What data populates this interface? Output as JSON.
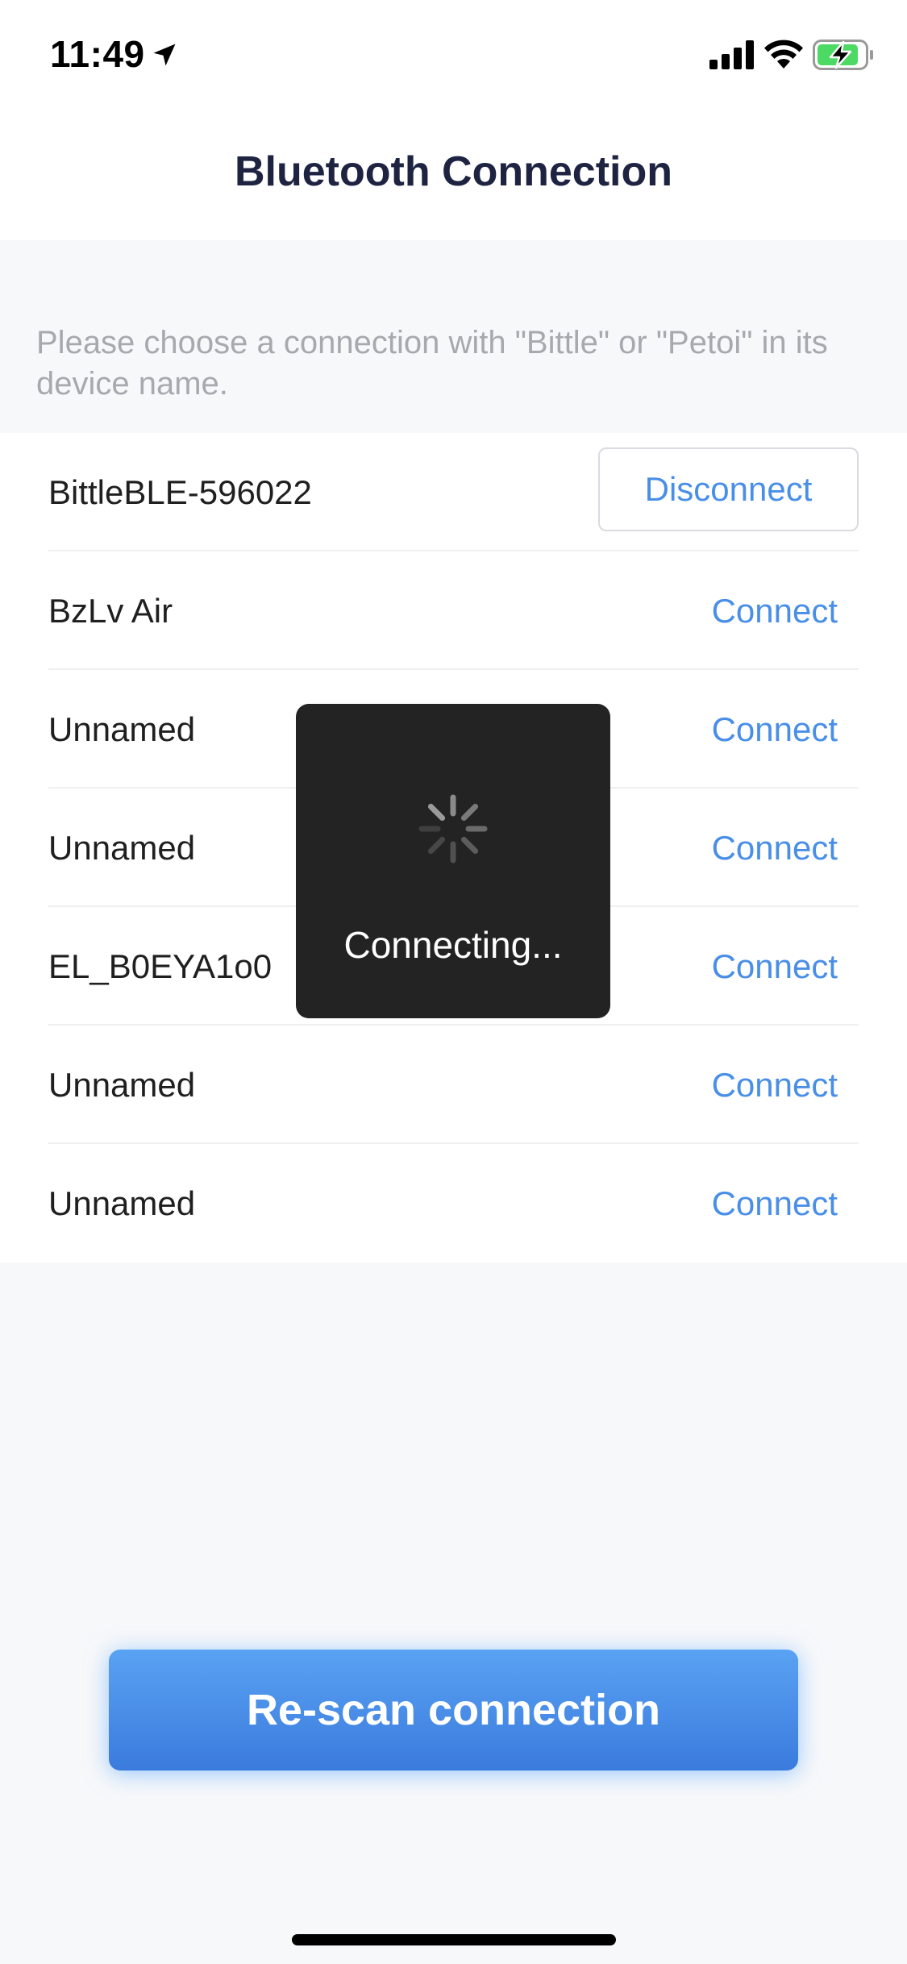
{
  "status_bar": {
    "time": "11:49",
    "icons": [
      "location-arrow-icon",
      "signal-icon",
      "wifi-icon",
      "battery-charging-icon"
    ],
    "battery_color": "#4cd964"
  },
  "header": {
    "title": "Bluetooth Connection"
  },
  "instruction": "Please choose a connection with \"Bittle\" or \"Petoi\" in its device name.",
  "devices": [
    {
      "name": "BittleBLE-596022",
      "action": "Disconnect"
    },
    {
      "name": "BzLv Air",
      "action": "Connect"
    },
    {
      "name": "Unnamed",
      "action": "Connect"
    },
    {
      "name": "Unnamed",
      "action": "Connect"
    },
    {
      "name": "EL_B0EYA1o0",
      "action": "Connect"
    },
    {
      "name": "Unnamed",
      "action": "Connect"
    },
    {
      "name": "Unnamed",
      "action": "Connect"
    }
  ],
  "overlay": {
    "text": "Connecting..."
  },
  "rescan_button": {
    "label": "Re-scan connection"
  },
  "colors": {
    "accent": "#4a8fe7",
    "title": "#1d2341",
    "background": "#f7f8fa",
    "overlay": "#232323"
  }
}
